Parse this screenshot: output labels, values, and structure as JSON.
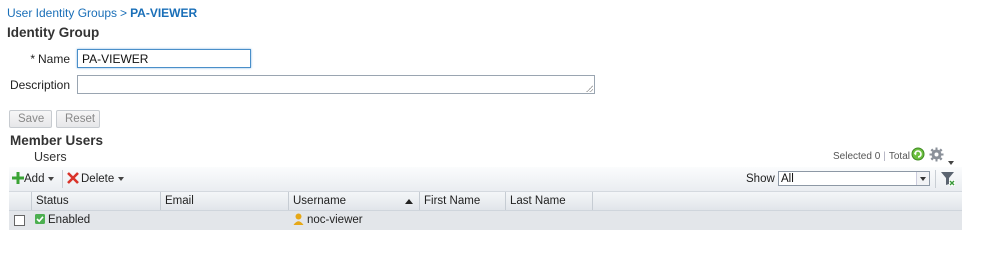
{
  "breadcrumb": {
    "parent": "User Identity Groups",
    "separator": ">",
    "current": "PA-VIEWER"
  },
  "identity_group": {
    "heading": "Identity Group",
    "required_marker": "*",
    "name_label": "Name",
    "name_value": "PA-VIEWER",
    "description_label": "Description",
    "description_value": ""
  },
  "form_buttons": {
    "save": "Save",
    "reset": "Reset"
  },
  "member_users": {
    "heading": "Member Users",
    "panel_title": "Users",
    "selected_label": "Selected 0",
    "total_label": "Total 1",
    "toolbar": {
      "add": "Add",
      "delete": "Delete",
      "show_label": "Show",
      "show_value": "All"
    },
    "columns": [
      "Status",
      "Email",
      "Username",
      "First Name",
      "Last Name"
    ],
    "sorted_column": "Username",
    "rows": [
      {
        "status": "Enabled",
        "email": "",
        "username": "noc-viewer",
        "first_name": "",
        "last_name": ""
      }
    ]
  },
  "colors": {
    "link": "#1a6fb8",
    "focus_border": "#4a8fc9",
    "add_icon": "#3aa335",
    "delete_icon": "#d9332a",
    "enabled_icon": "#4caf50"
  },
  "icons": [
    "add-icon",
    "delete-icon",
    "refresh-icon",
    "gear-icon",
    "filter-icon",
    "enabled-status-icon",
    "user-icon",
    "sort-asc-icon"
  ]
}
